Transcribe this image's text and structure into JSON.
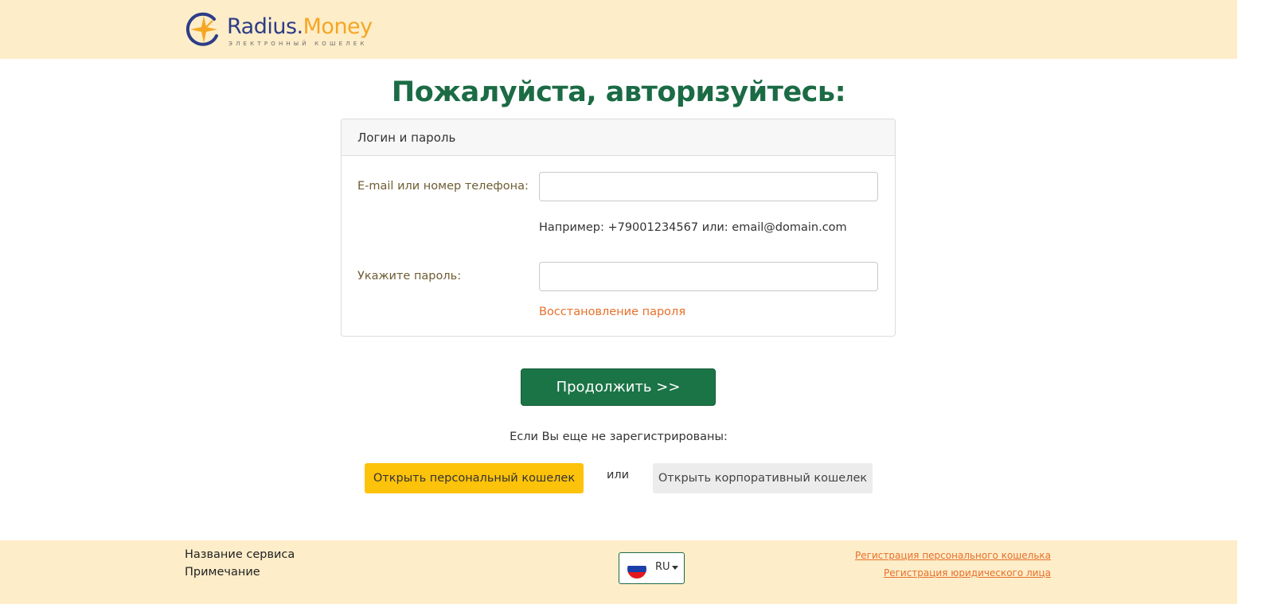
{
  "header": {
    "logo": {
      "name_part1": "Radius.",
      "name_part2": "Money",
      "tagline": "ЭЛЕКТРОННЫЙ КОШЕЛЕК"
    }
  },
  "main": {
    "title": "Пожалуйста, авторизуйтесь:",
    "card": {
      "header": "Логин и пароль",
      "login_label": "E-mail или номер телефона:",
      "login_value": "",
      "login_hint": "Например: +79001234567 или: email@domain.com",
      "password_label": "Укажите пароль:",
      "password_value": "",
      "recover_link": "Восстановление пароля"
    },
    "continue_button": "Продолжить >>",
    "not_registered": "Если Вы еще не зарегистрированы:",
    "open_personal_button": "Открыть персональный кошелек",
    "or_text": "или",
    "open_corporate_button": "Открыть корпоративный кошелек"
  },
  "footer": {
    "service_name": "Название сервиса",
    "note": "Примечание",
    "language": "RU",
    "link_personal": "Регистрация персонального кошелька",
    "link_legal": "Регистрация юридического лица"
  },
  "colors": {
    "header_bg": "#fdedc9",
    "title_green": "#1b6b45",
    "button_green": "#1b7446",
    "button_yellow": "#fdc20a",
    "link_orange": "#e8702a",
    "logo_blue": "#2d3d87",
    "logo_orange": "#f5a623"
  }
}
